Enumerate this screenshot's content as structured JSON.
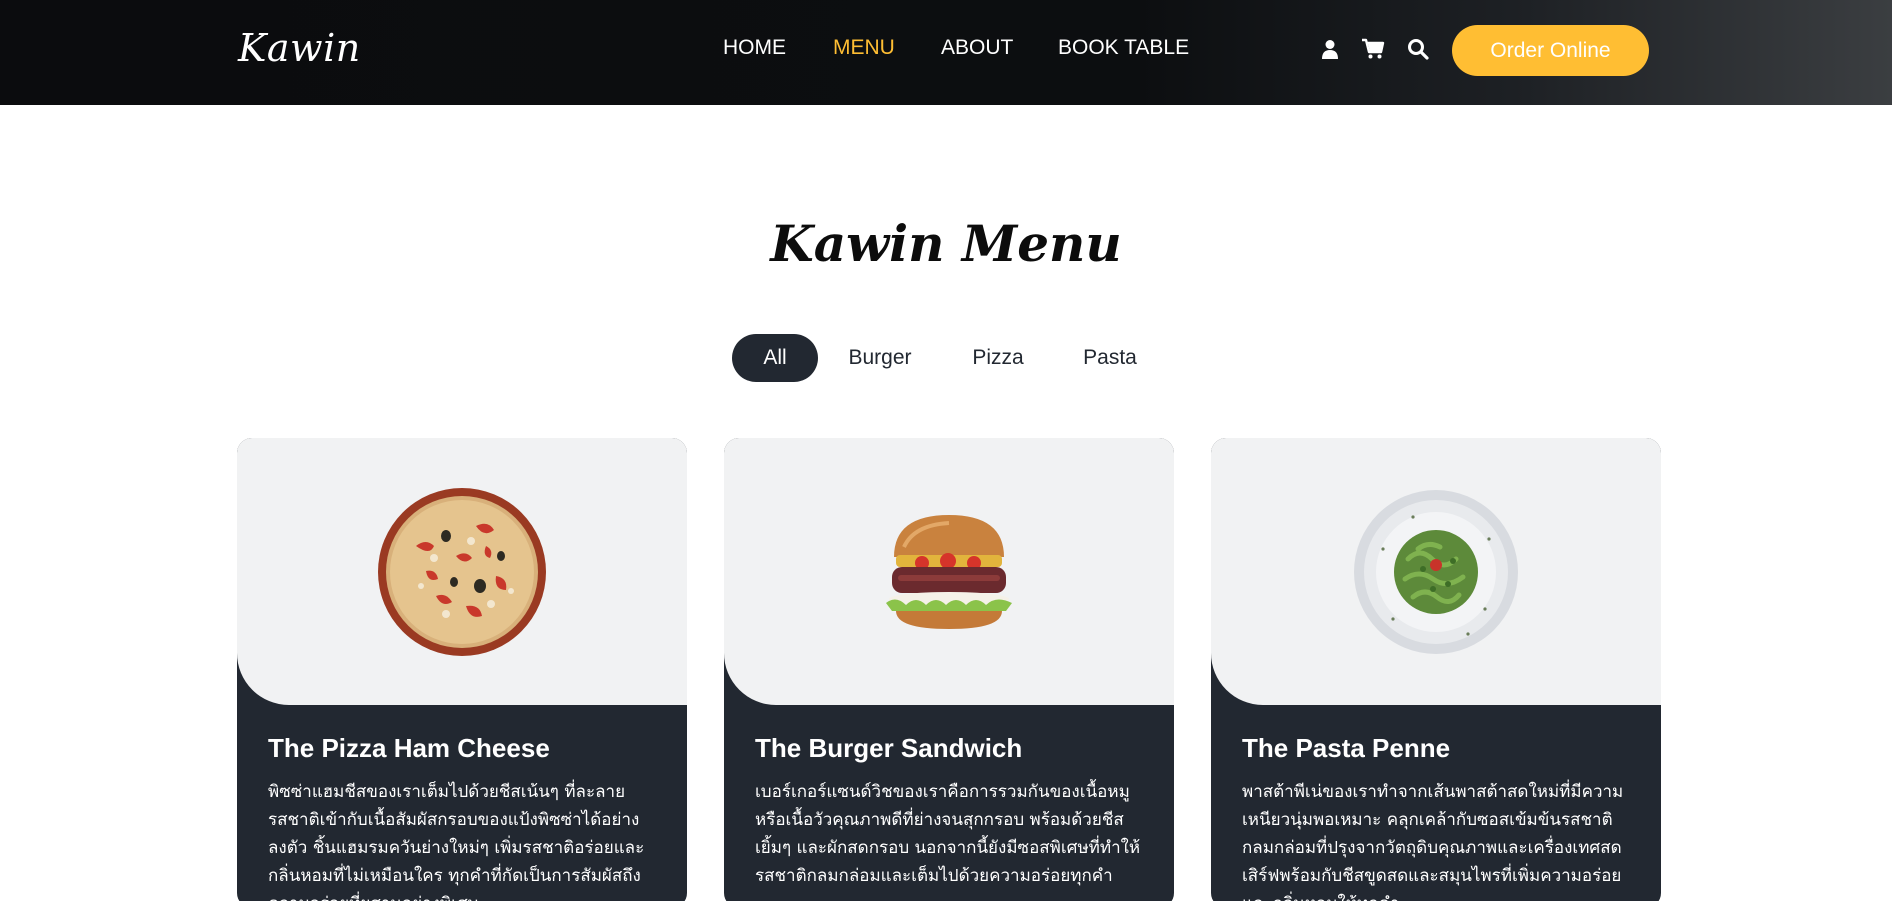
{
  "brand": "Kawin",
  "nav": {
    "items": [
      {
        "label": "HOME",
        "active": false
      },
      {
        "label": "MENU",
        "active": true
      },
      {
        "label": "ABOUT",
        "active": false
      },
      {
        "label": "BOOK TABLE",
        "active": false
      }
    ],
    "icons": [
      "user-icon",
      "cart-icon",
      "search-icon"
    ],
    "order_button": "Order Online"
  },
  "menu": {
    "title": "Kawin Menu",
    "filters": [
      {
        "label": "All",
        "active": true
      },
      {
        "label": "Burger",
        "active": false
      },
      {
        "label": "Pizza",
        "active": false
      },
      {
        "label": "Pasta",
        "active": false
      }
    ],
    "cards": [
      {
        "title": "The Pizza Ham Cheese",
        "image": "pizza-image",
        "description": "พิซซ่าแฮมชีสของเราเต็มไปด้วยชีสเน้นๆ ที่ละลายรสชาติเข้ากับเนื้อสัมผัสกรอบของแป้งพิซซ่าได้อย่างลงตัว ชิ้นแฮมรมควันย่างใหม่ๆ เพิ่มรสชาติอร่อยและกลิ่นหอมที่ไม่เหมือนใคร ทุกคำที่กัดเป็นการสัมผัสถึงความอร่อยที่ผสานอย่างพิเศษ"
      },
      {
        "title": "The Burger Sandwich",
        "image": "burger-image",
        "description": "เบอร์เกอร์แซนด์วิชของเราคือการรวมกันของเนื้อหมูหรือเนื้อวัวคุณภาพดีที่ย่างจนสุกกรอบ พร้อมด้วยชีสเยิ้มๆ และผักสดกรอบ นอกจากนี้ยังมีซอสพิเศษที่ทำให้รสชาติกลมกล่อมและเต็มไปด้วยความอร่อยทุกคำ"
      },
      {
        "title": "The Pasta Penne",
        "image": "pasta-image",
        "description": "พาสต้าพีเน่ของเราทำจากเส้นพาสต้าสดใหม่ที่มีความเหนียวนุ่มพอเหมาะ คลุกเคล้ากับซอสเข้มข้นรสชาติกลมกล่อมที่ปรุงจากวัตถุดิบคุณภาพและเครื่องเทศสด เสิร์ฟพร้อมกับชีสขูดสดและสมุนไพรที่เพิ่มความอร่อยและกลิ่นหอมให้ทุกคำ"
      }
    ]
  },
  "colors": {
    "accent": "#ffbe33",
    "dark": "#222831",
    "header": "#0c0e10",
    "image_bg": "#f1f2f3"
  }
}
